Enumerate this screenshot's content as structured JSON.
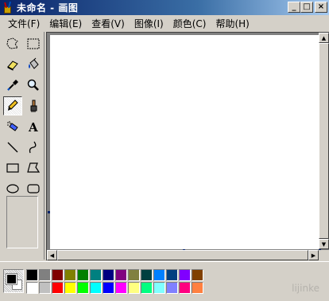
{
  "window": {
    "title": "未命名 - 画图"
  },
  "menubar": {
    "items": [
      "文件(F)",
      "编辑(E)",
      "查看(V)",
      "图像(I)",
      "颜色(C)",
      "帮助(H)"
    ]
  },
  "toolbox": {
    "tools": [
      {
        "icon": "free-select-icon"
      },
      {
        "icon": "rect-select-icon"
      },
      {
        "icon": "eraser-icon"
      },
      {
        "icon": "fill-bucket-icon"
      },
      {
        "icon": "color-picker-icon"
      },
      {
        "icon": "magnifier-icon"
      },
      {
        "icon": "pencil-icon",
        "active": true
      },
      {
        "icon": "brush-icon"
      },
      {
        "icon": "airbrush-icon"
      },
      {
        "icon": "text-icon",
        "label": "A"
      },
      {
        "icon": "line-icon"
      },
      {
        "icon": "curve-icon"
      },
      {
        "icon": "rectangle-icon"
      },
      {
        "icon": "polygon-icon"
      },
      {
        "icon": "ellipse-icon"
      },
      {
        "icon": "rounded-rect-icon"
      }
    ]
  },
  "colors": {
    "foreground": "#000000",
    "background": "#ffffff",
    "palette": [
      "#000000",
      "#808080",
      "#800000",
      "#808000",
      "#008000",
      "#008080",
      "#000080",
      "#800080",
      "#808040",
      "#004040",
      "#0080ff",
      "#004080",
      "#8000ff",
      "#804000",
      "#ffffff",
      "#c0c0c0",
      "#ff0000",
      "#ffff00",
      "#00ff00",
      "#00ffff",
      "#0000ff",
      "#ff00ff",
      "#ffff80",
      "#00ff80",
      "#80ffff",
      "#8080ff",
      "#ff0080",
      "#ff8040"
    ]
  },
  "watermark": "lijinke"
}
